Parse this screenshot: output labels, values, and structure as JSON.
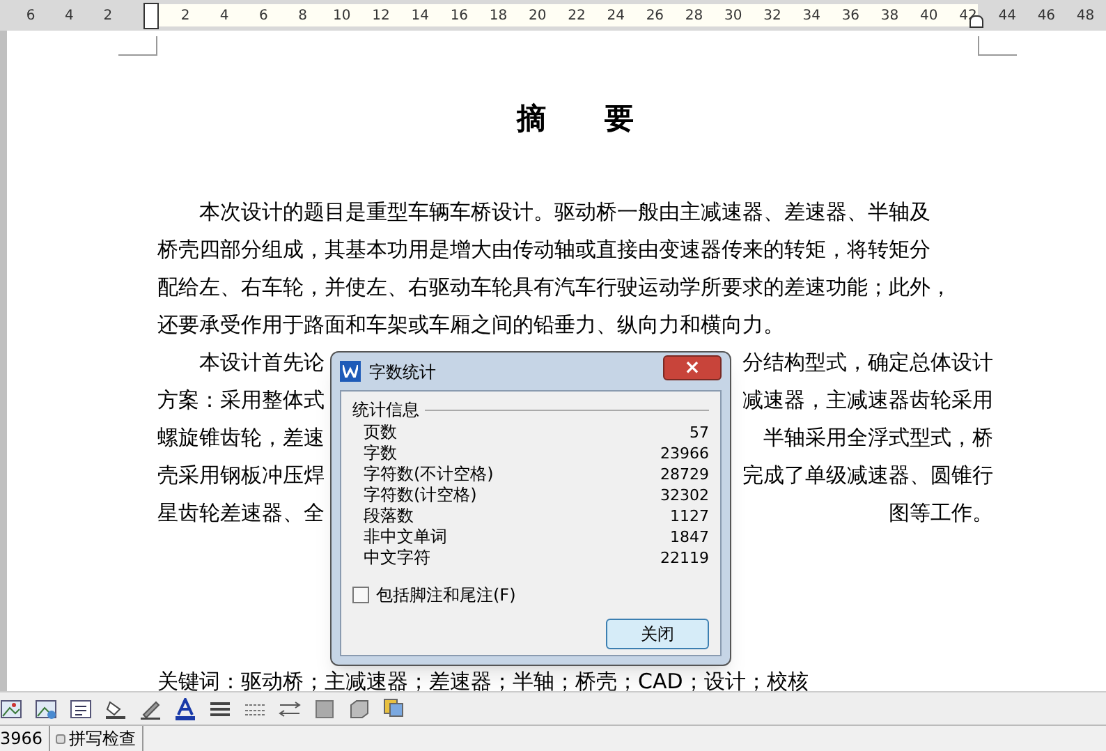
{
  "ruler": {
    "left_marks": [
      "6",
      "4",
      "2"
    ],
    "right_marks": [
      "2",
      "4",
      "6",
      "8",
      "10",
      "12",
      "14",
      "16",
      "18",
      "20",
      "22",
      "24",
      "26",
      "28",
      "30",
      "32",
      "34",
      "36",
      "38",
      "40",
      "42",
      "44",
      "46",
      "48"
    ]
  },
  "document": {
    "title": "摘　　要",
    "paragraph_1": [
      "本次设计的题目是重型车辆车桥设计。驱动桥一般由主减速器、差速器、半轴及",
      "桥壳四部分组成，其基本功用是增大由传动轴或直接由变速器传来的转矩，将转矩分",
      "配给左、右车轮，并使左、右驱动车轮具有汽车行驶运动学所要求的差速功能；此外，",
      "还要承受作用于路面和车架或车厢之间的铅垂力、纵向力和横向力。"
    ],
    "paragraph_2": [
      {
        "left": "本设计首先论",
        "right": "分结构型式，确定总体设计"
      },
      {
        "left": "方案：采用整体式",
        "right": "减速器，主减速器齿轮采用"
      },
      {
        "left": "螺旋锥齿轮，差速",
        "right": "半轴采用全浮式型式，桥"
      },
      {
        "left": "壳采用钢板冲压焊",
        "right": "完成了单级减速器、圆锥行"
      },
      {
        "left": "星齿轮差速器、全",
        "right": "图等工作。"
      }
    ],
    "keywords": "关键词：驱动桥；主减速器；差速器；半轴；桥壳；CAD；设计；校核"
  },
  "dialog": {
    "title": "字数统计",
    "close_glyph": "×",
    "group": "统计信息",
    "stats": [
      {
        "label": "页数",
        "value": "57"
      },
      {
        "label": "字数",
        "value": "23966"
      },
      {
        "label": "字符数(不计空格)",
        "value": "28729"
      },
      {
        "label": "字符数(计空格)",
        "value": "32302"
      },
      {
        "label": "段落数",
        "value": "1127"
      },
      {
        "label": "非中文单词",
        "value": "1847"
      },
      {
        "label": "中文字符",
        "value": "22119"
      }
    ],
    "include_notes": {
      "label": "包括脚注和尾注(F)",
      "checked": false
    },
    "button": "关闭"
  },
  "status_bar": {
    "word_count": "3966",
    "spell_check": "拼写检查"
  }
}
